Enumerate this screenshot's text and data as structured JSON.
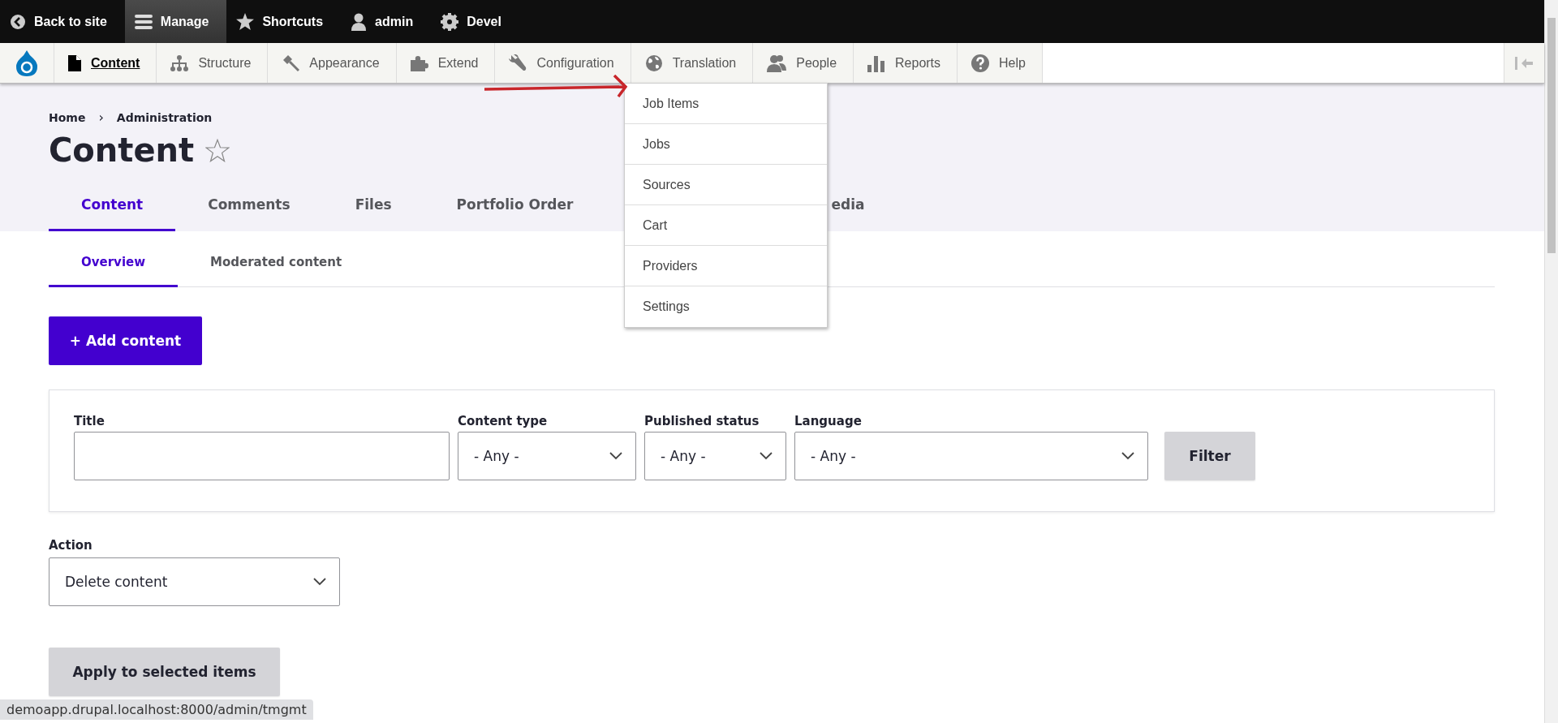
{
  "toolbar": {
    "items": [
      {
        "label": "Back to site",
        "kind": "back",
        "selected": false
      },
      {
        "label": "Manage",
        "kind": "menu",
        "selected": true
      },
      {
        "label": "Shortcuts",
        "kind": "star",
        "selected": false
      },
      {
        "label": "admin",
        "kind": "user",
        "selected": false
      },
      {
        "label": "Devel",
        "kind": "gear",
        "selected": false
      }
    ]
  },
  "tray": {
    "items": [
      {
        "label": "Content",
        "kind": "page",
        "selected": true
      },
      {
        "label": "Structure",
        "kind": "sitemap",
        "selected": false
      },
      {
        "label": "Appearance",
        "kind": "brush",
        "selected": false
      },
      {
        "label": "Extend",
        "kind": "puzzle",
        "selected": false
      },
      {
        "label": "Configuration",
        "kind": "wrench",
        "selected": false
      },
      {
        "label": "Translation",
        "kind": "globe",
        "selected": false
      },
      {
        "label": "People",
        "kind": "people",
        "selected": false
      },
      {
        "label": "Reports",
        "kind": "chart",
        "selected": false
      },
      {
        "label": "Help",
        "kind": "help",
        "selected": false
      }
    ]
  },
  "breadcrumb": [
    "Home",
    "Administration"
  ],
  "breadcrumb_separator": "›",
  "page_title": "Content",
  "primary_tabs": [
    {
      "label": "Content",
      "selected": true
    },
    {
      "label": "Comments",
      "selected": false
    },
    {
      "label": "Files",
      "selected": false
    },
    {
      "label": "Portfolio Order",
      "selected": false
    },
    {
      "label": "edia",
      "selected": false
    }
  ],
  "secondary_tabs": [
    {
      "label": "Overview",
      "selected": true
    },
    {
      "label": "Moderated content",
      "selected": false
    }
  ],
  "add_button": "+ Add content",
  "filters": {
    "fields": [
      {
        "label": "Title",
        "kind": "text"
      },
      {
        "label": "Content type",
        "kind": "select",
        "value": "- Any -"
      },
      {
        "label": "Published status",
        "kind": "select",
        "value": "- Any -"
      },
      {
        "label": "Language",
        "kind": "select",
        "value": "- Any -"
      }
    ],
    "button": "Filter"
  },
  "action": {
    "label": "Action",
    "value": "Delete content"
  },
  "apply_button": "Apply to selected items",
  "dropdown_menu": {
    "items": [
      "Job Items",
      "Jobs",
      "Sources",
      "Cart",
      "Providers",
      "Settings"
    ]
  },
  "status_bar": {
    "url": "demoapp.drupal.localhost:8000/admin/tmgmt"
  }
}
